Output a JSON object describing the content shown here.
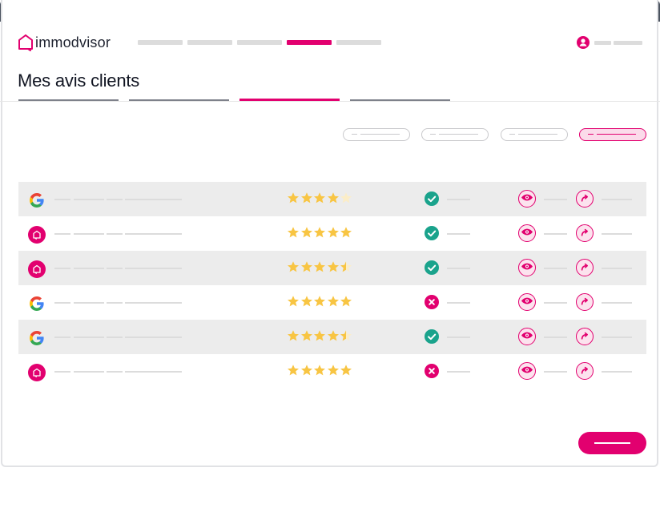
{
  "app": {
    "name": "immodvisor",
    "accent_color": "#e2006f",
    "success_color": "#1aa38c",
    "star_color": "#f8c543"
  },
  "header": {
    "nav_items": [
      {
        "state": "inactive"
      },
      {
        "state": "inactive"
      },
      {
        "state": "inactive"
      },
      {
        "state": "active"
      },
      {
        "state": "inactive"
      }
    ],
    "user": {
      "icon": "user-icon"
    }
  },
  "page": {
    "title": "Mes avis clients"
  },
  "tabs": [
    {
      "state": "inactive"
    },
    {
      "state": "inactive"
    },
    {
      "state": "active"
    },
    {
      "state": "inactive"
    }
  ],
  "filters": [
    {
      "state": "inactive"
    },
    {
      "state": "inactive"
    },
    {
      "state": "inactive"
    },
    {
      "state": "active"
    }
  ],
  "reviews": [
    {
      "source": "google",
      "rating": 4,
      "published": true
    },
    {
      "source": "immodvisor",
      "rating": 5,
      "published": true
    },
    {
      "source": "immodvisor",
      "rating": 4.5,
      "published": true
    },
    {
      "source": "google",
      "rating": 5,
      "published": false
    },
    {
      "source": "google",
      "rating": 4.5,
      "published": true
    },
    {
      "source": "immodvisor",
      "rating": 5,
      "published": false
    }
  ],
  "row_actions": [
    {
      "icon": "eye-icon"
    },
    {
      "icon": "reply-arrow-icon"
    }
  ],
  "footer": {
    "primary_button": {
      "icon": "dash"
    }
  }
}
